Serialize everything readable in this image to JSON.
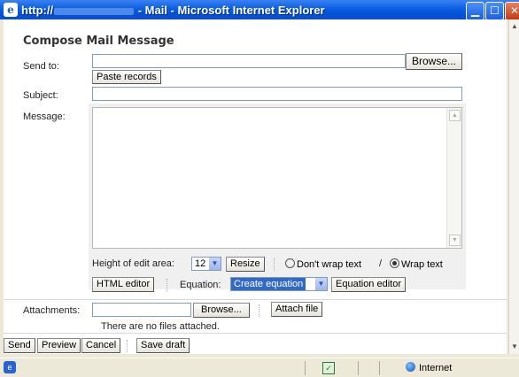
{
  "window": {
    "title_prefix": "http://",
    "title_suffix": " - Mail - Microsoft Internet Explorer",
    "min_glyph": "▁",
    "max_glyph": "☐",
    "close_glyph": "✕"
  },
  "page": {
    "title": "Compose Mail Message"
  },
  "send_to": {
    "label": "Send to:",
    "value": "",
    "browse_label": "Browse...",
    "paste_label": "Paste records"
  },
  "subject": {
    "label": "Subject:",
    "value": ""
  },
  "message": {
    "label": "Message:",
    "value": ""
  },
  "edit_options": {
    "height_label": "Height of edit area:",
    "height_value": "12",
    "resize_label": "Resize",
    "no_wrap_label": "Don't wrap text",
    "divider": "/",
    "wrap_label": "Wrap text",
    "wrap_selected": "wrap"
  },
  "editor_options": {
    "html_editor_label": "HTML editor",
    "equation_label": "Equation:",
    "equation_value": "Create equation",
    "equation_editor_label": "Equation editor"
  },
  "attachments": {
    "label": "Attachments:",
    "value": "",
    "browse_label": "Browse...",
    "attach_label": "Attach file",
    "empty_text": "There are no files attached."
  },
  "actions": {
    "send": "Send",
    "preview": "Preview",
    "cancel": "Cancel",
    "save_draft": "Save draft"
  },
  "statusbar": {
    "zone": "Internet"
  },
  "colors": {
    "titlebar": "#0a5fe0",
    "window_bg": "#ece9d8",
    "selected_option": "#316ac5"
  }
}
